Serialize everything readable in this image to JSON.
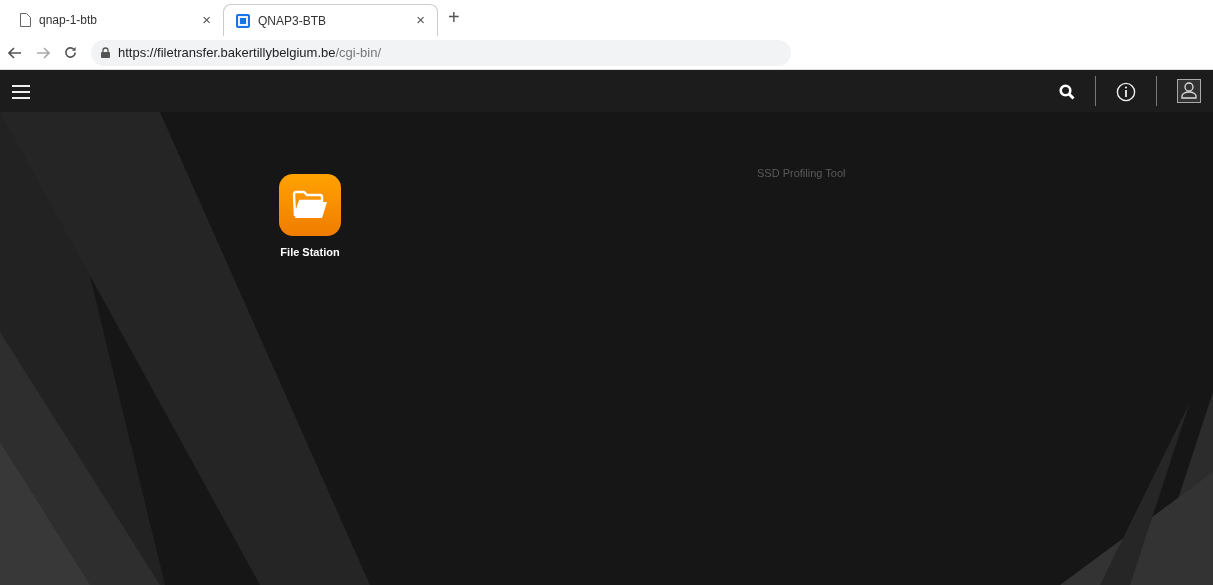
{
  "browser": {
    "tabs": [
      {
        "title": "qnap-1-btb",
        "close": "×",
        "selected": false,
        "kind": "page"
      },
      {
        "title": "QNAP3-BTB",
        "close": "×",
        "selected": true,
        "kind": "app"
      }
    ],
    "new_tab": "+",
    "url": {
      "host": "https://filetransfer.bakertillybelgium.be",
      "path": "/cgi-bin/"
    }
  },
  "desktop": {
    "apps": [
      {
        "label": "File Station"
      }
    ],
    "faint_text": "SSD Profiling Tool"
  }
}
